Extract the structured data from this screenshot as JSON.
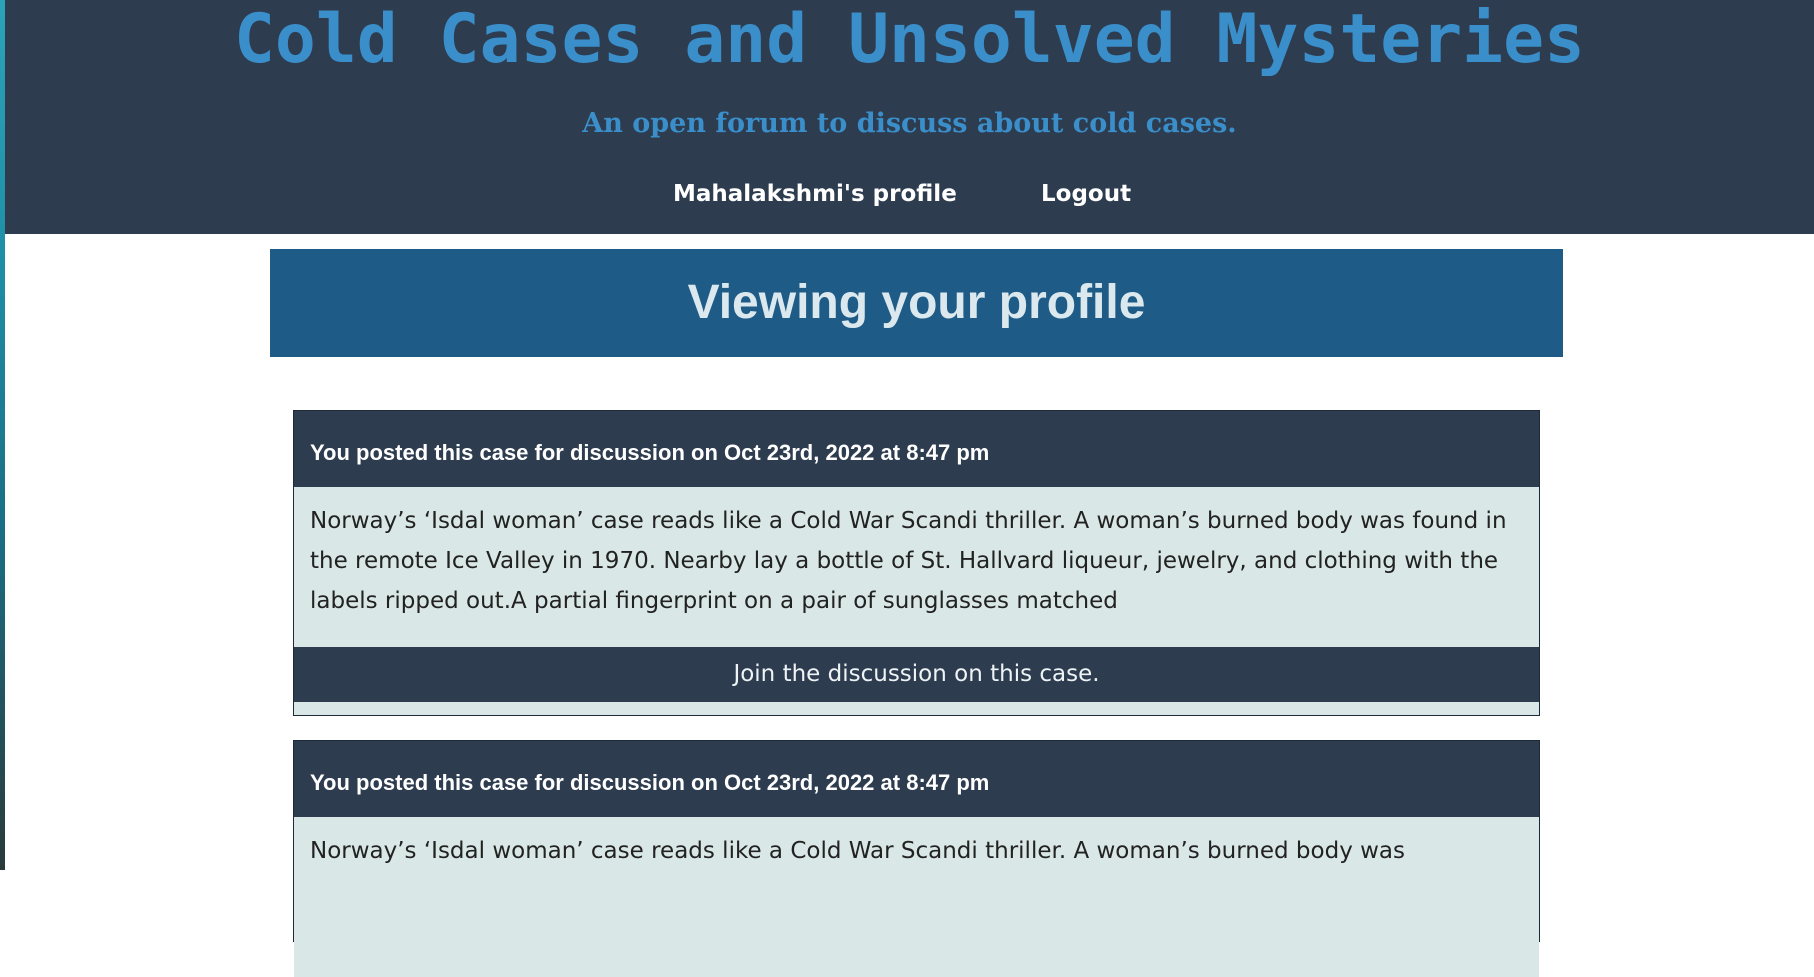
{
  "header": {
    "title": "Cold Cases and Unsolved Mysteries",
    "subtitle": "An open forum to discuss about cold cases."
  },
  "nav": {
    "profile_label": "Mahalakshmi's profile",
    "logout_label": "Logout"
  },
  "main": {
    "heading": "Viewing your profile",
    "cases": [
      {
        "meta": "You posted this case for discussion on Oct 23rd, 2022 at 8:47 pm",
        "excerpt": "Norway’s ‘Isdal woman’ case reads like a Cold War Scandi thriller. A woman’s burned body was found in the remote Ice Valley in 1970. Nearby lay a bottle of St. Hallvard liqueur, jewelry, and clothing with the labels ripped out.A partial fingerprint on a pair of sunglasses matched",
        "link_label": "Join the discussion on this case."
      },
      {
        "meta": "You posted this case for discussion on Oct 23rd, 2022 at 8:47 pm",
        "excerpt": "Norway’s ‘Isdal woman’ case reads like a Cold War Scandi thriller. A woman’s burned body was"
      }
    ]
  },
  "colors": {
    "header_bg": "#2e3c50",
    "title_accent": "#3a8fca",
    "banner_bg": "#1e5b87",
    "card_body_bg": "#d9e8e6"
  }
}
